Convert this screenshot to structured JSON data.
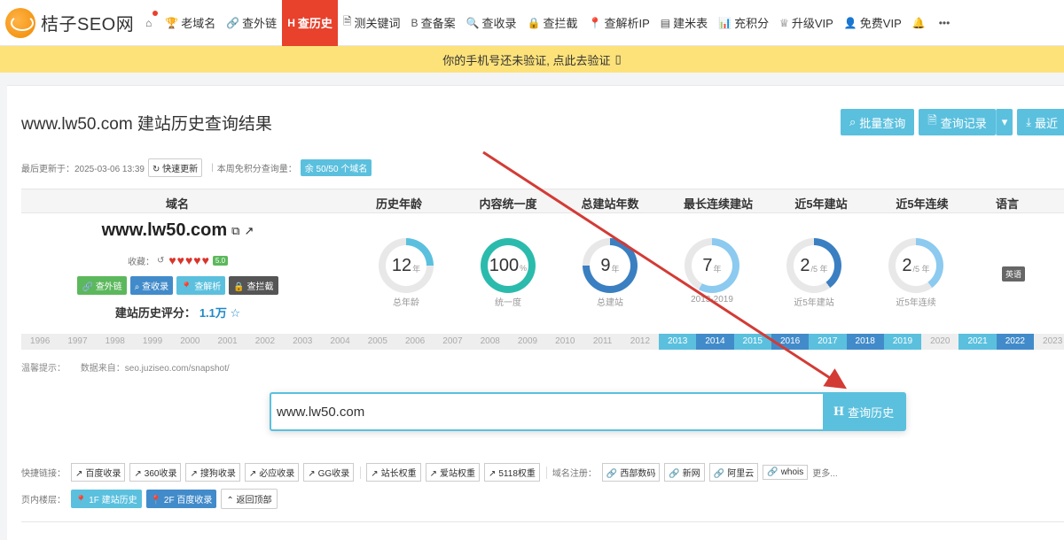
{
  "logo": {
    "text": "桔子SEO网"
  },
  "nav": [
    {
      "icon": "⌂",
      "label": ""
    },
    {
      "icon": "🏆",
      "label": "老域名"
    },
    {
      "icon": "🔗",
      "label": "查外链"
    },
    {
      "icon": "H",
      "label": "查历史",
      "active": true
    },
    {
      "icon": "🗎",
      "label": "测关键词"
    },
    {
      "icon": "B",
      "label": "查备案"
    },
    {
      "icon": "🔍",
      "label": "查收录"
    },
    {
      "icon": "🔒",
      "label": "查拦截"
    },
    {
      "icon": "📍",
      "label": "查解析IP"
    },
    {
      "icon": "▤",
      "label": "建米表"
    },
    {
      "icon": "📊",
      "label": "充积分"
    },
    {
      "icon": "♕",
      "label": "升级VIP"
    },
    {
      "icon": "👤",
      "label": "免费VIP"
    },
    {
      "icon": "🔔",
      "label": ""
    },
    {
      "icon": "•••",
      "label": ""
    }
  ],
  "warn": {
    "text": "你的手机号还未验证, 点此去验证",
    "icon": "▯"
  },
  "title": "www.lw50.com 建站历史查询结果",
  "toolbar": {
    "batch": "批量查询",
    "records": "查询记录",
    "recent": "最近"
  },
  "meta": {
    "updated": "最后更新于：2025-03-06 13:39",
    "refresh": "快速更新",
    "quota_label": "本周免积分查询量：",
    "quota": "余 50/50 个域名"
  },
  "headers": [
    "域名",
    "历史年龄",
    "内容统一度",
    "总建站年数",
    "最长连续建站",
    "近5年建站",
    "近5年连续",
    "语言"
  ],
  "domain": {
    "name": "www.lw50.com",
    "fav_label": "收藏：",
    "hearts": "♥♥♥♥♥",
    "badge": "5.0",
    "score_label": "建站历史评分：",
    "score": "1.1万"
  },
  "domain_btns": [
    "查外链",
    "查收录",
    "查解析",
    "查拦截"
  ],
  "metrics": [
    {
      "value": "12",
      "unit": "年",
      "caption": "总年龄",
      "pct": 0.25,
      "color": "#5bc0de"
    },
    {
      "value": "100",
      "unit": "%",
      "caption": "统一度",
      "pct": 1.0,
      "color": "#2bbbad"
    },
    {
      "value": "9",
      "unit": "年",
      "caption": "总建站",
      "pct": 0.75,
      "color": "#3a7fc1"
    },
    {
      "value": "7",
      "unit": "年",
      "caption": "2013-2019",
      "pct": 0.58,
      "color": "#8ccaf0"
    },
    {
      "value": "2",
      "unit": "/5 年",
      "caption": "近5年建站",
      "pct": 0.4,
      "color": "#3a7fc1"
    },
    {
      "value": "2",
      "unit": "/5 年",
      "caption": "近5年连续",
      "pct": 0.4,
      "color": "#8ccaf0"
    }
  ],
  "language": "英语",
  "years": [
    {
      "y": "1996"
    },
    {
      "y": "1997"
    },
    {
      "y": "1998"
    },
    {
      "y": "1999"
    },
    {
      "y": "2000"
    },
    {
      "y": "2001"
    },
    {
      "y": "2002"
    },
    {
      "y": "2003"
    },
    {
      "y": "2004"
    },
    {
      "y": "2005"
    },
    {
      "y": "2006"
    },
    {
      "y": "2007"
    },
    {
      "y": "2008"
    },
    {
      "y": "2009"
    },
    {
      "y": "2010"
    },
    {
      "y": "2011"
    },
    {
      "y": "2012"
    },
    {
      "y": "2013",
      "s": "on"
    },
    {
      "y": "2014",
      "s": "dk"
    },
    {
      "y": "2015",
      "s": "on"
    },
    {
      "y": "2016",
      "s": "dk"
    },
    {
      "y": "2017",
      "s": "on"
    },
    {
      "y": "2018",
      "s": "dk"
    },
    {
      "y": "2019",
      "s": "on"
    },
    {
      "y": "2020"
    },
    {
      "y": "2021",
      "s": "on"
    },
    {
      "y": "2022",
      "s": "dk"
    },
    {
      "y": "2023"
    }
  ],
  "tip": {
    "label": "温馨提示：",
    "text": "数据来自：seo.juziseo.com/snapshot/"
  },
  "search": {
    "value": "www.lw50.com",
    "button": "查询历史"
  },
  "quick_label": "快捷链接：",
  "quick_links": [
    "百度收录",
    "360收录",
    "搜狗收录",
    "必应收录",
    "GG收录"
  ],
  "weight_links": [
    "站长权重",
    "爱站权重",
    "5118权重"
  ],
  "reg_label": "域名注册：",
  "reg_links": [
    "西部数码",
    "新网",
    "阿里云",
    "whois"
  ],
  "more": "更多...",
  "floor_label": "页内楼层：",
  "floors": [
    "1F 建站历史",
    "2F 百度收录",
    "返回顶部"
  ]
}
